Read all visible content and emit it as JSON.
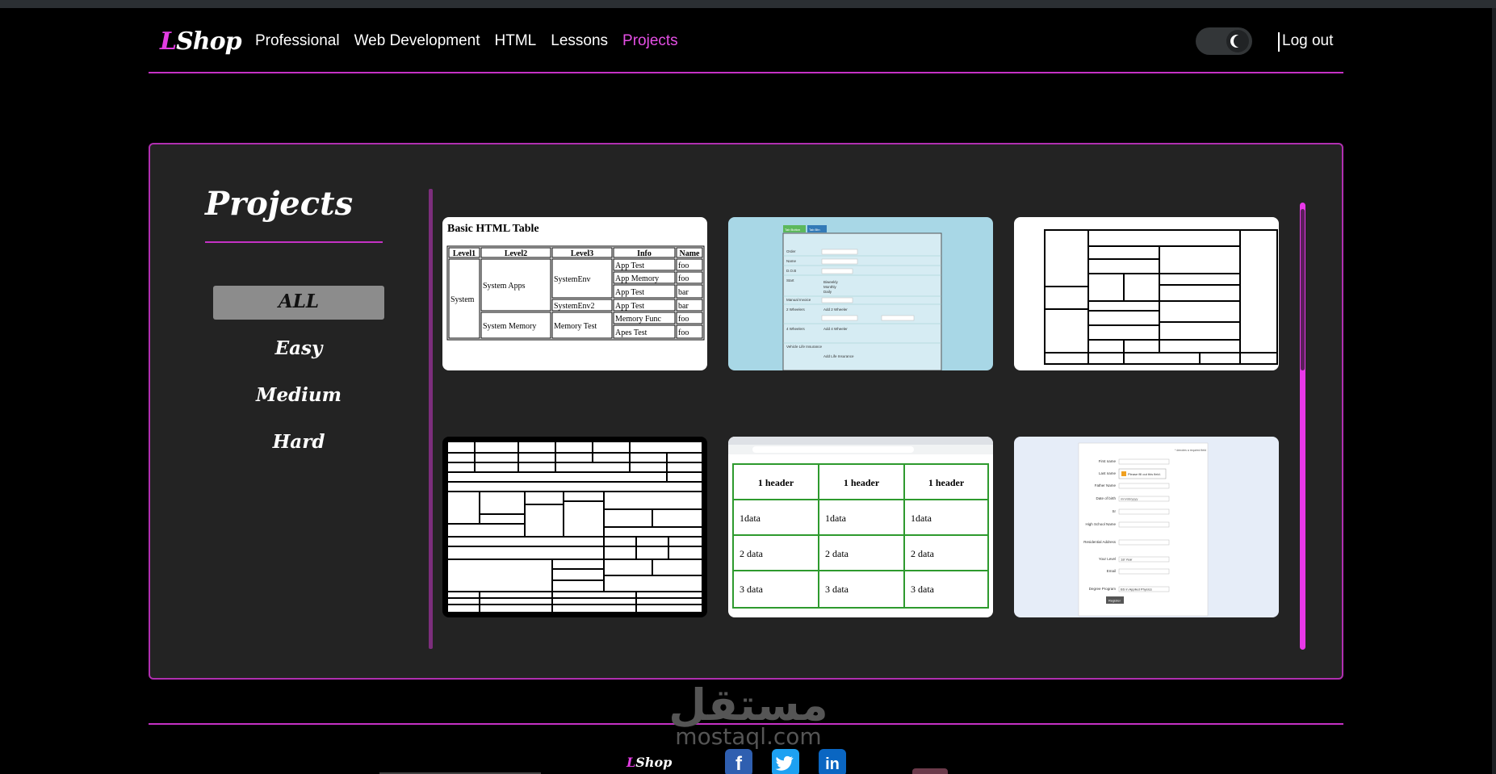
{
  "brand": {
    "logo_first": "L",
    "logo_rest": "Shop"
  },
  "nav": {
    "links": [
      "Professional",
      "Web Development",
      "HTML",
      "Lessons",
      "Projects"
    ],
    "active": "Projects",
    "logout": "Log out",
    "theme_mode": "dark"
  },
  "projects": {
    "title": "Projects",
    "filters": [
      "ALL",
      "Easy",
      "Medium",
      "Hard"
    ],
    "selected_filter": "ALL"
  },
  "cards": {
    "table1": {
      "title": "Basic HTML Table",
      "headers": [
        "Level1",
        "Level2",
        "Level3",
        "Info",
        "Name"
      ],
      "level1": "System",
      "level2": [
        "System Apps",
        "System Memory"
      ],
      "level3": [
        "SystemEnv",
        "SystemEnv2",
        "Memory Test"
      ],
      "info": [
        "App Test",
        "App Memory",
        "App Test",
        "App Test",
        "Memory Func",
        "Apes Test"
      ],
      "names": [
        "foo",
        "foo",
        "bar",
        "bar",
        "foo",
        "foo"
      ]
    },
    "form2": {
      "buttons": [
        "Tab Button",
        "Tab Btn"
      ],
      "fields": [
        "Order",
        "Name",
        "D.O.B",
        "Start",
        "Manual Invoice",
        "2 Wheelers",
        "4 Wheelers",
        "Vehicle Life Insurance"
      ],
      "radios": [
        "Biweekly",
        "Monthly",
        "Daily"
      ],
      "sub": [
        "Add 2 Wheeler",
        "Add 4 Wheeler",
        "Add Life Insurance"
      ]
    },
    "grid5": {
      "headers": [
        "1 header",
        "1 header",
        "1 header"
      ],
      "rows": [
        [
          "1data",
          "1data",
          "1data"
        ],
        [
          "2 data",
          "2 data",
          "2 data"
        ],
        [
          "3 data",
          "3 data",
          "3 data"
        ]
      ]
    },
    "form6": {
      "labels": [
        "First name",
        "Last name",
        "Father Name",
        "Date of birth",
        "Sr",
        "High School Name",
        "Residential Address",
        "Your Level",
        "Email",
        "Degree Program"
      ],
      "hint": "Please fill out this field.",
      "date_placeholder": "mm/dd/yyyy",
      "level_value": "1st Year",
      "program_value": "BS in Applied Physics",
      "register": "Register",
      "note": "* denotes a required field"
    }
  },
  "footer": {
    "logo_first": "L",
    "logo_rest": "Shop",
    "social": [
      "facebook",
      "twitter",
      "linkedin"
    ]
  },
  "watermark": {
    "arabic": "مستقل",
    "latin": "mostaql.com"
  },
  "colors": {
    "accent": "#e23ce2",
    "panel": "#232323",
    "background": "#000000"
  }
}
